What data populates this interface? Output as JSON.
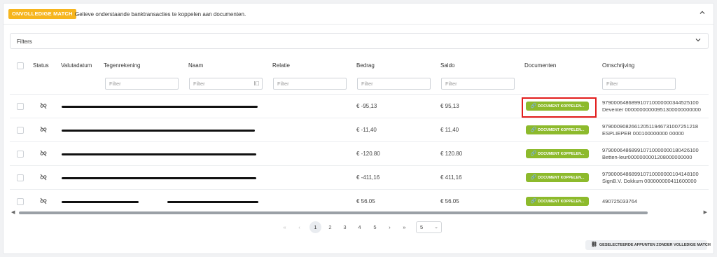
{
  "header": {
    "badge": "ONVOLLEDIGE MATCH",
    "message": "Gelieve onderstaande banktransacties te koppelen aan documenten.",
    "collapse_icon": "chevron-up-icon"
  },
  "filters_panel": {
    "label": "Filters",
    "expand_icon": "chevron-down-icon"
  },
  "table": {
    "columns": [
      "Status",
      "Valutadatum",
      "Tegenrekening",
      "Naam",
      "Relatie",
      "Bedrag",
      "Saldo",
      "Documenten",
      "Omschrijving"
    ],
    "filter_placeholder": "Filter",
    "rows": [
      {
        "status_icon": "unlinked-icon",
        "bedrag": "€ -95,13",
        "saldo": "€ 95,13",
        "doc_button": "DOCUMENT KOPPELEN...",
        "desc_line1": "979000648689910710000000344525100",
        "desc_line2": "Deventer 00000000000951300000000000"
      },
      {
        "status_icon": "unlinked-icon",
        "bedrag": "€ -11,40",
        "saldo": "€ 11,40",
        "doc_button": "DOCUMENT KOPPELEN...",
        "desc_line1": "979000908266120511946731007251218",
        "desc_line2": "ESPLIEPER 000100000000 00000"
      },
      {
        "status_icon": "unlinked-icon",
        "bedrag": "€ -120.80",
        "saldo": "€ 120.80",
        "doc_button": "DOCUMENT KOPPELEN...",
        "desc_line1": "979000648689910710000000180426100",
        "desc_line2": "Betten-leur0000000001208000000000"
      },
      {
        "status_icon": "unlinked-icon",
        "bedrag": "€ -411,16",
        "saldo": "€ 411,16",
        "doc_button": "DOCUMENT KOPPELEN...",
        "desc_line1": "979000648689910710000000104148100",
        "desc_line2": "SignB.V. Dokkum 000000000411600000"
      },
      {
        "status_icon": "unlinked-icon",
        "bedrag": "€ 56.05",
        "saldo": "€ 56.05",
        "doc_button": "DOCUMENT KOPPELEN...",
        "desc_line1": "490725033764",
        "desc_line2": ""
      }
    ]
  },
  "pagination": {
    "first": "«",
    "prev": "‹",
    "pages": [
      "1",
      "2",
      "3",
      "4",
      "5"
    ],
    "current_page": "1",
    "next": "›",
    "last": "»",
    "page_size": "5"
  },
  "footer": {
    "action_button": "GESELECTEERDE AFPUNTEN ZONDER VOLLEDIGE MATCH",
    "action_icon": "unlink-icon"
  },
  "colors": {
    "badge": "#f6b51e",
    "doc_button": "#8dba2c",
    "highlight": "#e21d1d"
  }
}
